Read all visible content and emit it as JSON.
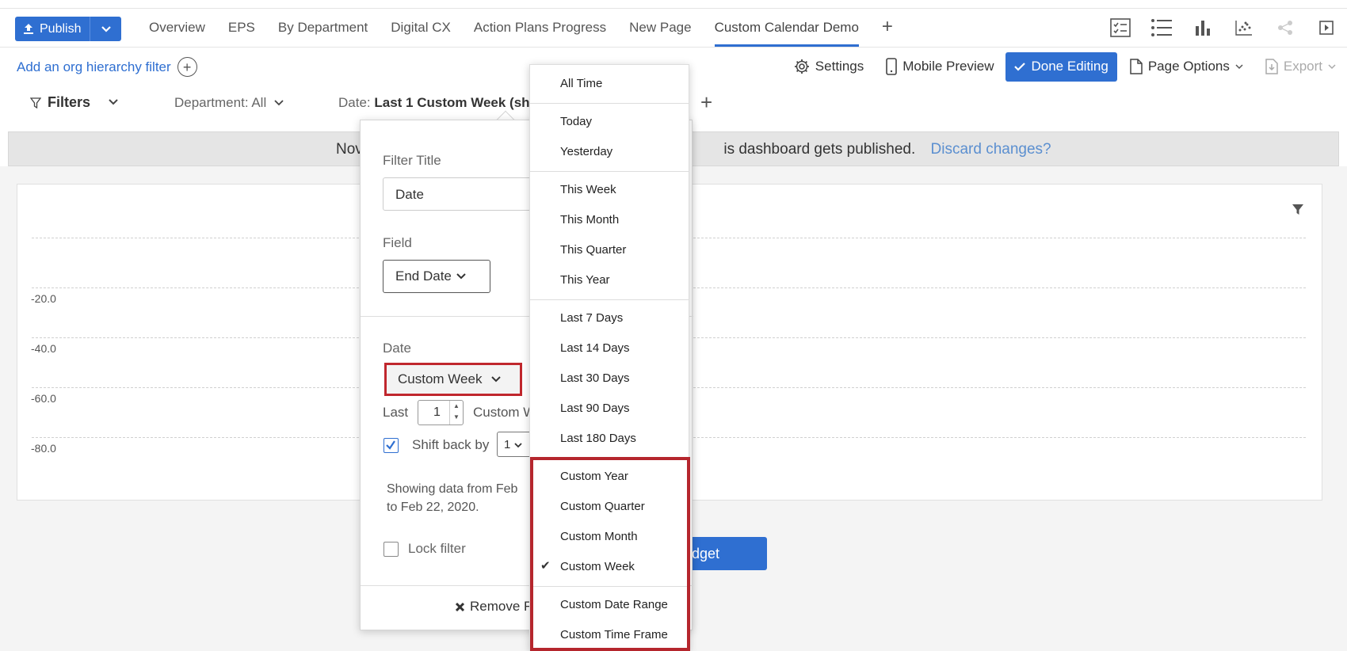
{
  "topbar": {
    "publish_label": "Publish",
    "tabs": [
      {
        "label": "Overview"
      },
      {
        "label": "EPS"
      },
      {
        "label": "By Department"
      },
      {
        "label": "Digital CX"
      },
      {
        "label": "Action Plans Progress"
      },
      {
        "label": "New Page"
      },
      {
        "label": "Custom Calendar Demo",
        "active": true
      }
    ],
    "add_tab": "+"
  },
  "subbar": {
    "org_filter": "Add an org hierarchy filter",
    "settings": "Settings",
    "mobile_preview": "Mobile Preview",
    "done_editing": "Done Editing",
    "page_options": "Page Options",
    "export": "Export"
  },
  "filterbar": {
    "filters": "Filters",
    "department": "Department: All",
    "date_prefix": "Date: ",
    "date_value": "Last 1 Custom Week (shi",
    "add": "+"
  },
  "notice": {
    "left_text": "Nov",
    "right_text": "is dashboard gets published.",
    "link": "Discard changes?"
  },
  "chart": {
    "y_labels": [
      "-20.0",
      "-40.0",
      "-60.0",
      "-80.0"
    ]
  },
  "add_widget_label": "idget",
  "panel": {
    "filter_title_label": "Filter Title",
    "filter_title_value": "Date",
    "field_label": "Field",
    "field_value": "End Date",
    "date_label": "Date",
    "date_type": "Custom Week",
    "last_label": "Last",
    "last_value": "1",
    "last_unit": "Custom W",
    "shift_label": "Shift back by",
    "shift_value": "1",
    "showing": "Showing data from Feb",
    "showing_2": "to Feb 22, 2020.",
    "lock_label": "Lock filter",
    "remove_label": "Remove F"
  },
  "dropdown": {
    "items": [
      "All Time",
      "Today",
      "Yesterday",
      "This Week",
      "This Month",
      "This Quarter",
      "This Year",
      "Last 7 Days",
      "Last 14 Days",
      "Last 30 Days",
      "Last 90 Days",
      "Last 180 Days",
      "Custom Year",
      "Custom Quarter",
      "Custom Month",
      "Custom Week",
      "Custom Date Range",
      "Custom Time Frame"
    ],
    "selected": "Custom Week"
  },
  "colors": {
    "accent": "#2f6fd1",
    "highlight": "#b5262d"
  }
}
